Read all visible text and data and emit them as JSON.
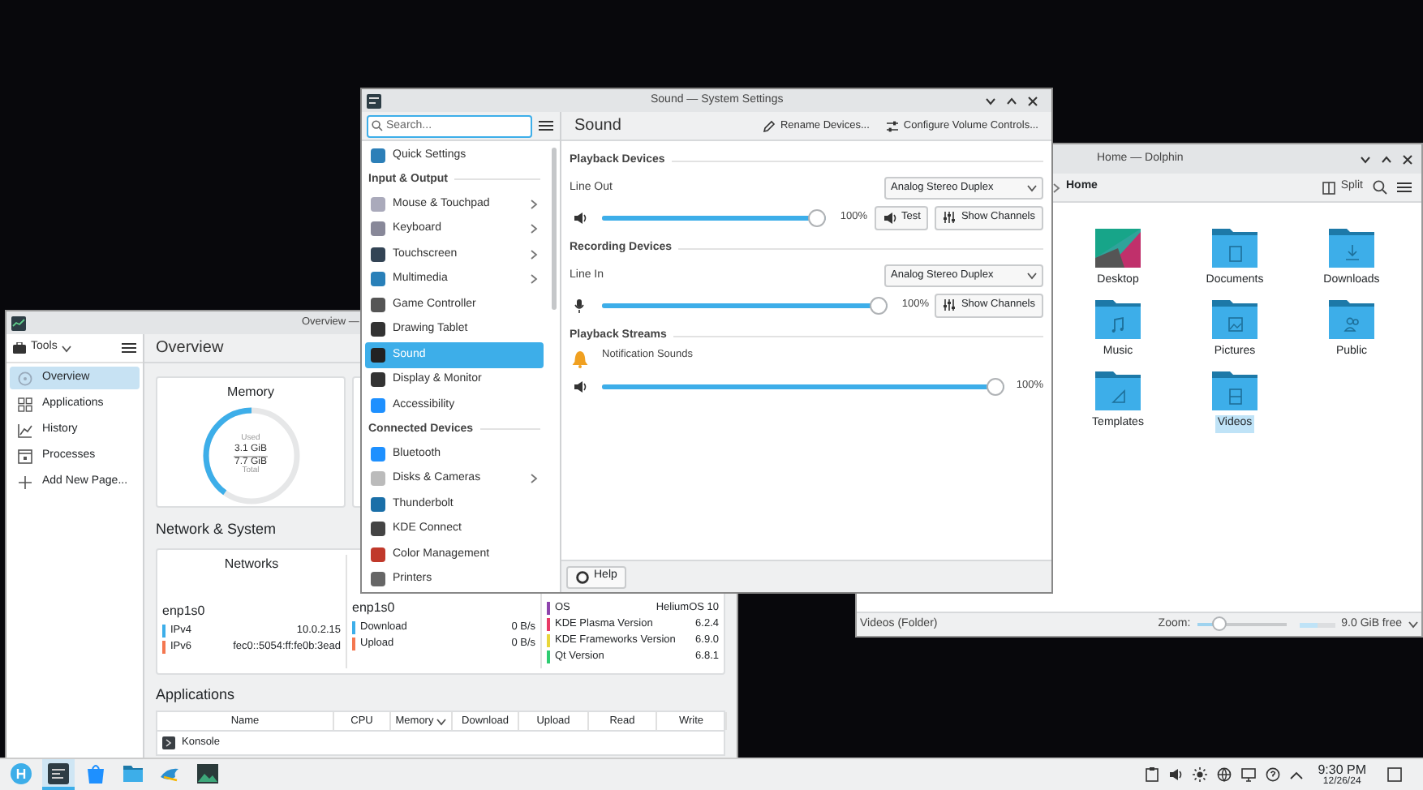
{
  "system_monitor": {
    "title": "Overview —",
    "tools_label": "Tools",
    "page_title": "Overview",
    "sidebar": [
      {
        "label": "Overview",
        "selected": true,
        "kind": "overview"
      },
      {
        "label": "Applications",
        "selected": false,
        "kind": "applications"
      },
      {
        "label": "History",
        "selected": false,
        "kind": "history"
      },
      {
        "label": "Processes",
        "selected": false,
        "kind": "processes"
      },
      {
        "label": "Add New Page...",
        "selected": false,
        "kind": "add"
      }
    ],
    "memory": {
      "title": "Memory",
      "used_label": "Used",
      "used": "3.1 GiB",
      "total": "7.7 GiB",
      "total_label": "Total",
      "level": 0.4
    },
    "network_section": "Network & System",
    "networks": {
      "title": "Networks",
      "interface": "enp1s0",
      "rows": [
        {
          "label": "IPv4",
          "value": "10.0.2.15",
          "color": "#3daee9"
        },
        {
          "label": "IPv6",
          "value": "fec0::5054:ff:fe0b:3ead",
          "color": "#f47750"
        }
      ]
    },
    "traffic": {
      "interface": "enp1s0",
      "rows": [
        {
          "label": "Download",
          "value": "0 B/s",
          "color": "#3daee9"
        },
        {
          "label": "Upload",
          "value": "0 B/s",
          "color": "#f47750"
        }
      ]
    },
    "system_info": [
      {
        "label": "OS",
        "value": "HeliumOS 10",
        "color": "#8e44ad"
      },
      {
        "label": "KDE Plasma Version",
        "value": "6.2.4",
        "color": "#e93a66"
      },
      {
        "label": "KDE Frameworks Version",
        "value": "6.9.0",
        "color": "#e9d63a"
      },
      {
        "label": "Qt Version",
        "value": "6.8.1",
        "color": "#2ecc71"
      }
    ],
    "applications_title": "Applications",
    "columns": [
      {
        "label": "Name",
        "sorted": false
      },
      {
        "label": "CPU",
        "sorted": false
      },
      {
        "label": "Memory",
        "sorted": true
      },
      {
        "label": "Download",
        "sorted": false
      },
      {
        "label": "Upload",
        "sorted": false
      },
      {
        "label": "Read",
        "sorted": false
      },
      {
        "label": "Write",
        "sorted": false
      }
    ],
    "rows": [
      {
        "name": "Konsole"
      }
    ]
  },
  "settings": {
    "title": "Sound — System Settings",
    "search_placeholder": "Search...",
    "page_title": "Sound",
    "actions": [
      {
        "label": "Rename Devices...",
        "kind": "pencil"
      },
      {
        "label": "Configure Volume Controls...",
        "kind": "sliders"
      }
    ],
    "sidebar": [
      {
        "kind": "item",
        "label": "Quick Settings",
        "selected": false,
        "expandable": false
      },
      {
        "kind": "header",
        "label": "Input & Output"
      },
      {
        "kind": "item",
        "label": "Mouse & Touchpad",
        "selected": false,
        "expandable": true
      },
      {
        "kind": "item",
        "label": "Keyboard",
        "selected": false,
        "expandable": true
      },
      {
        "kind": "item",
        "label": "Touchscreen",
        "selected": false,
        "expandable": true
      },
      {
        "kind": "item",
        "label": "Multimedia",
        "selected": false,
        "expandable": true
      },
      {
        "kind": "item",
        "label": "Game Controller",
        "selected": false,
        "expandable": false
      },
      {
        "kind": "item",
        "label": "Drawing Tablet",
        "selected": false,
        "expandable": false
      },
      {
        "kind": "item",
        "label": "Sound",
        "selected": true,
        "expandable": false
      },
      {
        "kind": "item",
        "label": "Display & Monitor",
        "selected": false,
        "expandable": false
      },
      {
        "kind": "item",
        "label": "Accessibility",
        "selected": false,
        "expandable": false
      },
      {
        "kind": "header",
        "label": "Connected Devices"
      },
      {
        "kind": "item",
        "label": "Bluetooth",
        "selected": false,
        "expandable": false
      },
      {
        "kind": "item",
        "label": "Disks & Cameras",
        "selected": false,
        "expandable": true
      },
      {
        "kind": "item",
        "label": "Thunderbolt",
        "selected": false,
        "expandable": false
      },
      {
        "kind": "item",
        "label": "KDE Connect",
        "selected": false,
        "expandable": false
      },
      {
        "kind": "item",
        "label": "Color Management",
        "selected": false,
        "expandable": false
      },
      {
        "kind": "item",
        "label": "Printers",
        "selected": false,
        "expandable": false
      }
    ],
    "sections": [
      {
        "title": "Playback Devices",
        "entries": [
          {
            "kind": "output",
            "name": "Line Out",
            "port": "Analog Stereo Duplex",
            "level": 1,
            "reading": "100%",
            "buttons": [
              {
                "label": "Test",
                "kind": "speaker"
              },
              {
                "label": "Show Channels",
                "kind": "sliders"
              }
            ]
          }
        ]
      },
      {
        "title": "Recording Devices",
        "entries": [
          {
            "kind": "input",
            "name": "Line In",
            "port": "Analog Stereo Duplex",
            "level": 1,
            "reading": "100%",
            "buttons": [
              {
                "label": "Show Channels",
                "kind": "sliders"
              }
            ]
          }
        ]
      },
      {
        "title": "Playback Streams",
        "entries": [
          {
            "kind": "stream",
            "name": "Notification Sounds",
            "level": 1,
            "reading": "100%"
          }
        ]
      }
    ],
    "help": "Help"
  },
  "dolphin": {
    "title": "Home — Dolphin",
    "breadcrumb": "Home",
    "split": "Split",
    "items": [
      {
        "label": "Desktop",
        "kind": "image",
        "selected": false
      },
      {
        "label": "Documents",
        "kind": "document",
        "selected": false
      },
      {
        "label": "Downloads",
        "kind": "download",
        "selected": false
      },
      {
        "label": "Music",
        "kind": "music",
        "selected": false
      },
      {
        "label": "Pictures",
        "kind": "picture",
        "selected": false
      },
      {
        "label": "Public",
        "kind": "people",
        "selected": false
      },
      {
        "label": "Templates",
        "kind": "template",
        "selected": false
      },
      {
        "label": "Videos",
        "kind": "video",
        "selected": true
      }
    ],
    "status": "Videos (Folder)",
    "zoom_label": "Zoom:",
    "zoom": {
      "level": 0.25
    },
    "space": {
      "level": 0.5
    },
    "free": "9.0 GiB free"
  },
  "taskbar": {
    "apps": [
      {
        "kind": "launcher",
        "selected": false
      },
      {
        "kind": "monitor",
        "selected": true
      },
      {
        "kind": "store",
        "selected": false
      },
      {
        "kind": "files",
        "selected": false
      },
      {
        "kind": "bird",
        "selected": false
      },
      {
        "kind": "image",
        "selected": false
      }
    ],
    "time": "9:30 PM",
    "date": "12/26/24"
  }
}
